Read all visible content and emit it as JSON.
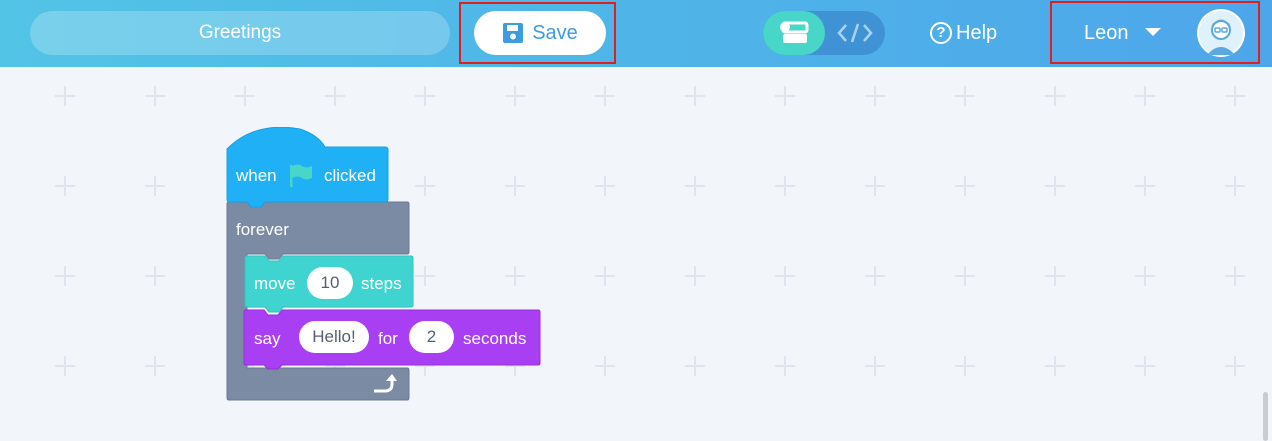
{
  "header": {
    "project_name": "Greetings",
    "save_label": "Save",
    "help_label": "Help",
    "user_name": "Leon",
    "mode_toggle": {
      "active": "blocks",
      "icons": [
        "blocks-icon",
        "code-icon"
      ]
    }
  },
  "script": {
    "hat_block": {
      "prefix": "when",
      "icon": "green-flag-icon",
      "suffix": "clicked"
    },
    "forever_block": {
      "label": "forever",
      "icon": "loop-arrow-icon"
    },
    "move_block": {
      "prefix": "move",
      "value": "10",
      "suffix": "steps"
    },
    "say_block": {
      "prefix": "say",
      "message": "Hello!",
      "middle": "for",
      "duration": "2",
      "suffix": "seconds"
    }
  },
  "colors": {
    "header_start": "#52c4e6",
    "header_end": "#4ea6ea",
    "event_block": "#1fb0f5",
    "control_block": "#7b8ba4",
    "motion_block": "#40d4d0",
    "looks_block": "#a93ff2",
    "highlight_box": "#e02020",
    "canvas_bg": "#f2f6fb"
  }
}
